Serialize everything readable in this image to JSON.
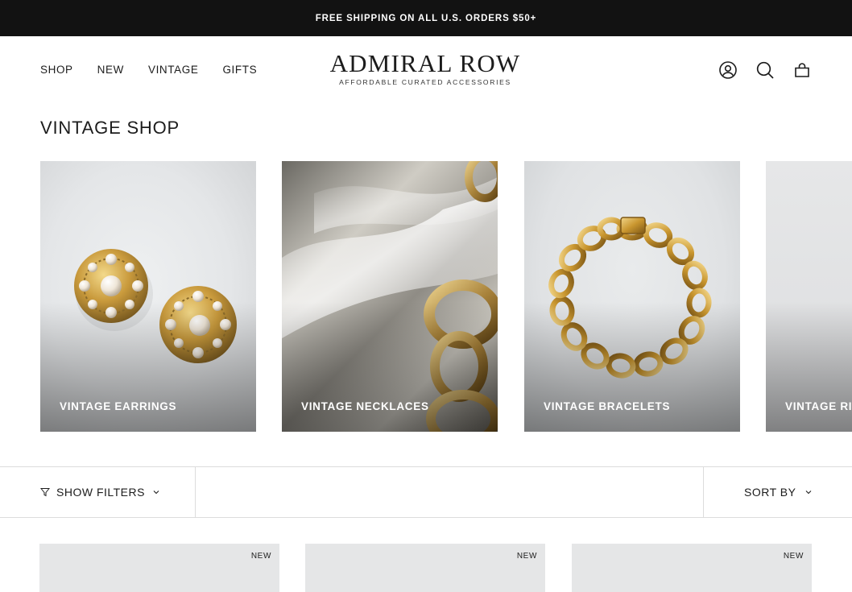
{
  "announcement": "FREE SHIPPING ON ALL U.S. ORDERS $50+",
  "nav": {
    "items": [
      {
        "label": "SHOP"
      },
      {
        "label": "NEW"
      },
      {
        "label": "VINTAGE"
      },
      {
        "label": "GIFTS"
      }
    ]
  },
  "logo": {
    "name": "ADMIRAL ROW",
    "tagline": "AFFORDABLE CURATED ACCESSORIES"
  },
  "header_icons": [
    "account-icon",
    "search-icon",
    "cart-icon"
  ],
  "page_title": "VINTAGE SHOP",
  "collections": [
    {
      "label": "VINTAGE EARRINGS"
    },
    {
      "label": "VINTAGE NECKLACES"
    },
    {
      "label": "VINTAGE BRACELETS"
    },
    {
      "label": "VINTAGE RINGS"
    }
  ],
  "toolbar": {
    "filters_label": "SHOW FILTERS",
    "sort_label": "SORT BY"
  },
  "products": [
    {
      "badge": "NEW"
    },
    {
      "badge": "NEW"
    },
    {
      "badge": "NEW"
    }
  ],
  "colors": {
    "announcement_bg": "#121212",
    "text": "#1c1c1c",
    "gold": "#c9a14a",
    "border": "#dcdcdc"
  }
}
